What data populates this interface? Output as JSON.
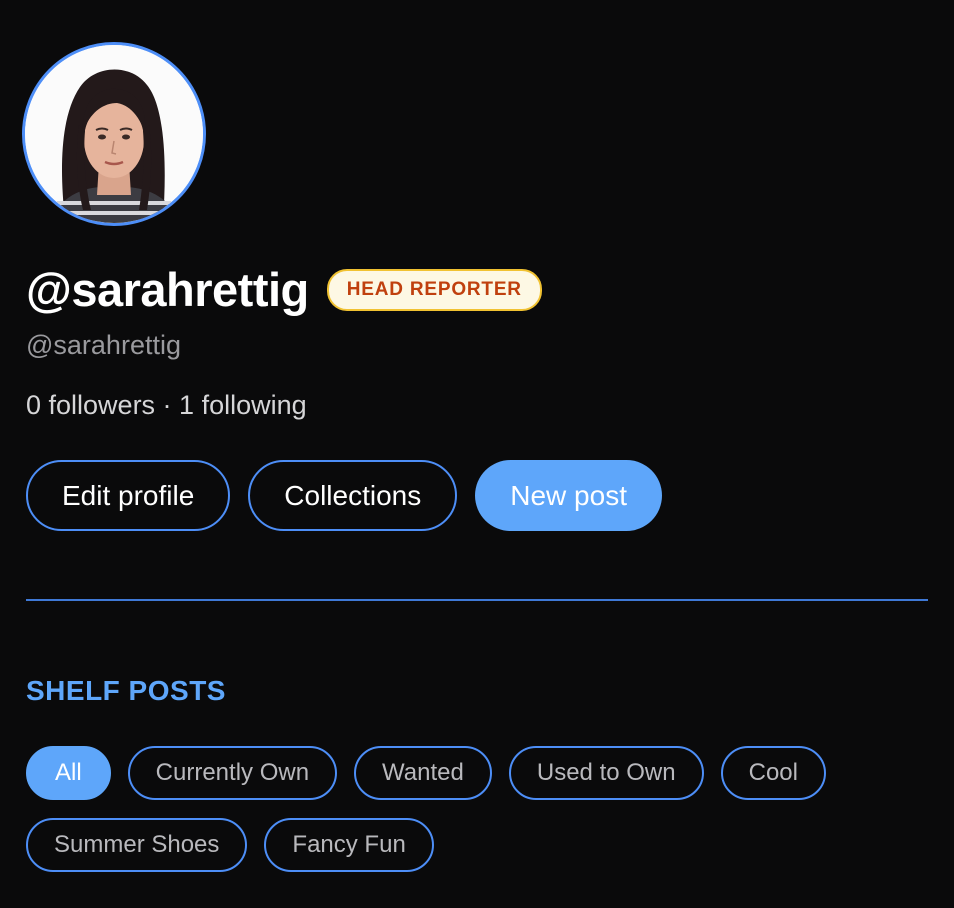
{
  "profile": {
    "display_name": "@sarahrettig",
    "handle": "@sarahrettig",
    "badge": "HEAD REPORTER",
    "follow_stats": "0 followers · 1 following",
    "avatar_alt": "profile-photo"
  },
  "actions": {
    "edit_profile": "Edit profile",
    "collections": "Collections",
    "new_post": "New post"
  },
  "shelf": {
    "title": "SHELF POSTS",
    "filters": [
      {
        "label": "All",
        "active": true
      },
      {
        "label": "Currently Own",
        "active": false
      },
      {
        "label": "Wanted",
        "active": false
      },
      {
        "label": "Used to Own",
        "active": false
      },
      {
        "label": "Cool",
        "active": false
      },
      {
        "label": "Summer Shoes",
        "active": false
      },
      {
        "label": "Fancy Fun",
        "active": false
      }
    ]
  },
  "colors": {
    "background": "#0a0a0b",
    "accent_blue": "#5ea6fa",
    "border_blue": "#4d8ef7",
    "badge_text": "#c0400e",
    "badge_border": "#f1c232",
    "badge_bg": "#fdf8e4"
  }
}
